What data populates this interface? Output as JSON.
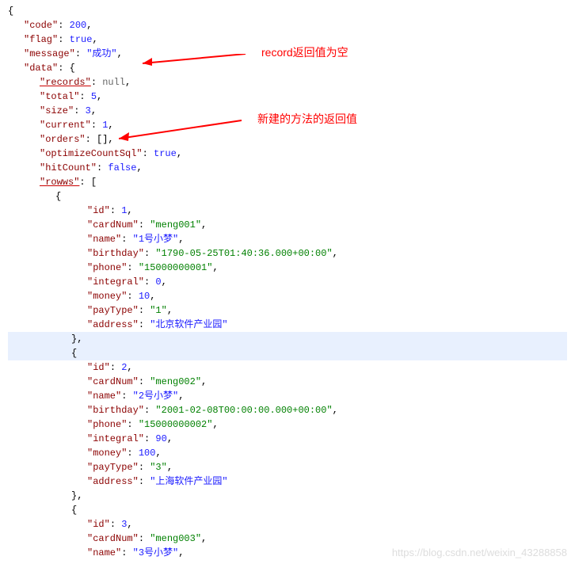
{
  "json": {
    "code": 200,
    "flag": "true",
    "message": "\"成功\"",
    "data_label": "\"data\"",
    "records": "null",
    "total": 5,
    "size": 3,
    "current": 1,
    "orders": "[]",
    "optimizeCountSql": "true",
    "hitCount": "false",
    "rowws_label": "\"rowws\"",
    "row1": {
      "id": 1,
      "cardNum": "\"meng001\"",
      "name": "\"1号小梦\"",
      "birthday": "\"1790-05-25T01:40:36.000+00:00\"",
      "phone": "\"15000000001\"",
      "integral": 0,
      "money": 10,
      "payType": "\"1\"",
      "address": "\"北京软件产业园\""
    },
    "row2": {
      "id": 2,
      "cardNum": "\"meng002\"",
      "name": "\"2号小梦\"",
      "birthday": "\"2001-02-08T00:00:00.000+00:00\"",
      "phone": "\"15000000002\"",
      "integral": 90,
      "money": 100,
      "payType": "\"3\"",
      "address": "\"上海软件产业园\""
    },
    "row3": {
      "id": 3,
      "cardNum": "\"meng003\"",
      "name": "\"3号小梦\""
    }
  },
  "annotations": {
    "a1": "record返回值为空",
    "a2": "新建的方法的返回值"
  },
  "watermark": "https://blog.csdn.net/weixin_43288858",
  "keys": {
    "code": "\"code\"",
    "flag": "\"flag\"",
    "message": "\"message\"",
    "records": "\"records\"",
    "total": "\"total\"",
    "size": "\"size\"",
    "current": "\"current\"",
    "orders": "\"orders\"",
    "optimizeCountSql": "\"optimizeCountSql\"",
    "hitCount": "\"hitCount\"",
    "id": "\"id\"",
    "cardNum": "\"cardNum\"",
    "name": "\"name\"",
    "birthday": "\"birthday\"",
    "phone": "\"phone\"",
    "integral": "\"integral\"",
    "money": "\"money\"",
    "payType": "\"payType\"",
    "address": "\"address\""
  }
}
